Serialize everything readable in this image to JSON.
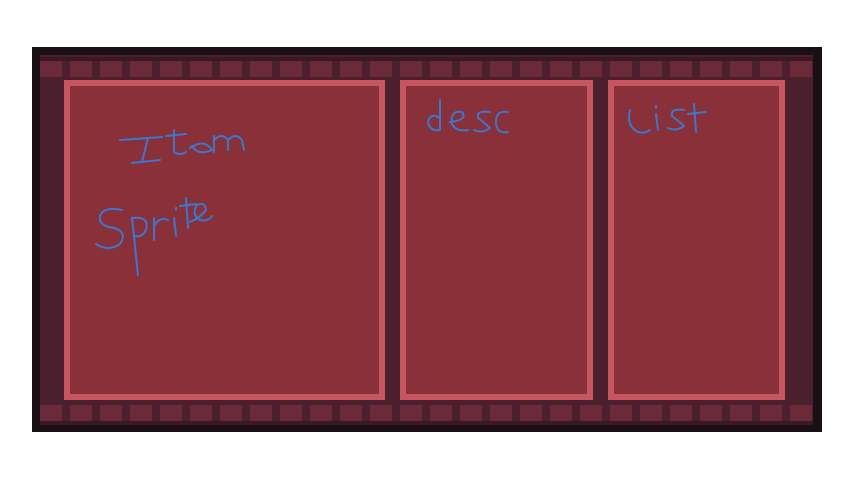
{
  "inventory_panel": {
    "frame_color": "#1a0f14",
    "inner_color": "#4a1f2e",
    "trim_color": "#6a2a3a",
    "panel_fill": "#8a3038",
    "panel_border": "#c85660",
    "annotation_color": "#3a78d0",
    "sections": [
      {
        "id": "sprite",
        "labels": [
          "Item",
          "Sprite"
        ]
      },
      {
        "id": "desc",
        "labels": [
          "desc"
        ]
      },
      {
        "id": "list",
        "labels": [
          "List"
        ]
      }
    ]
  }
}
